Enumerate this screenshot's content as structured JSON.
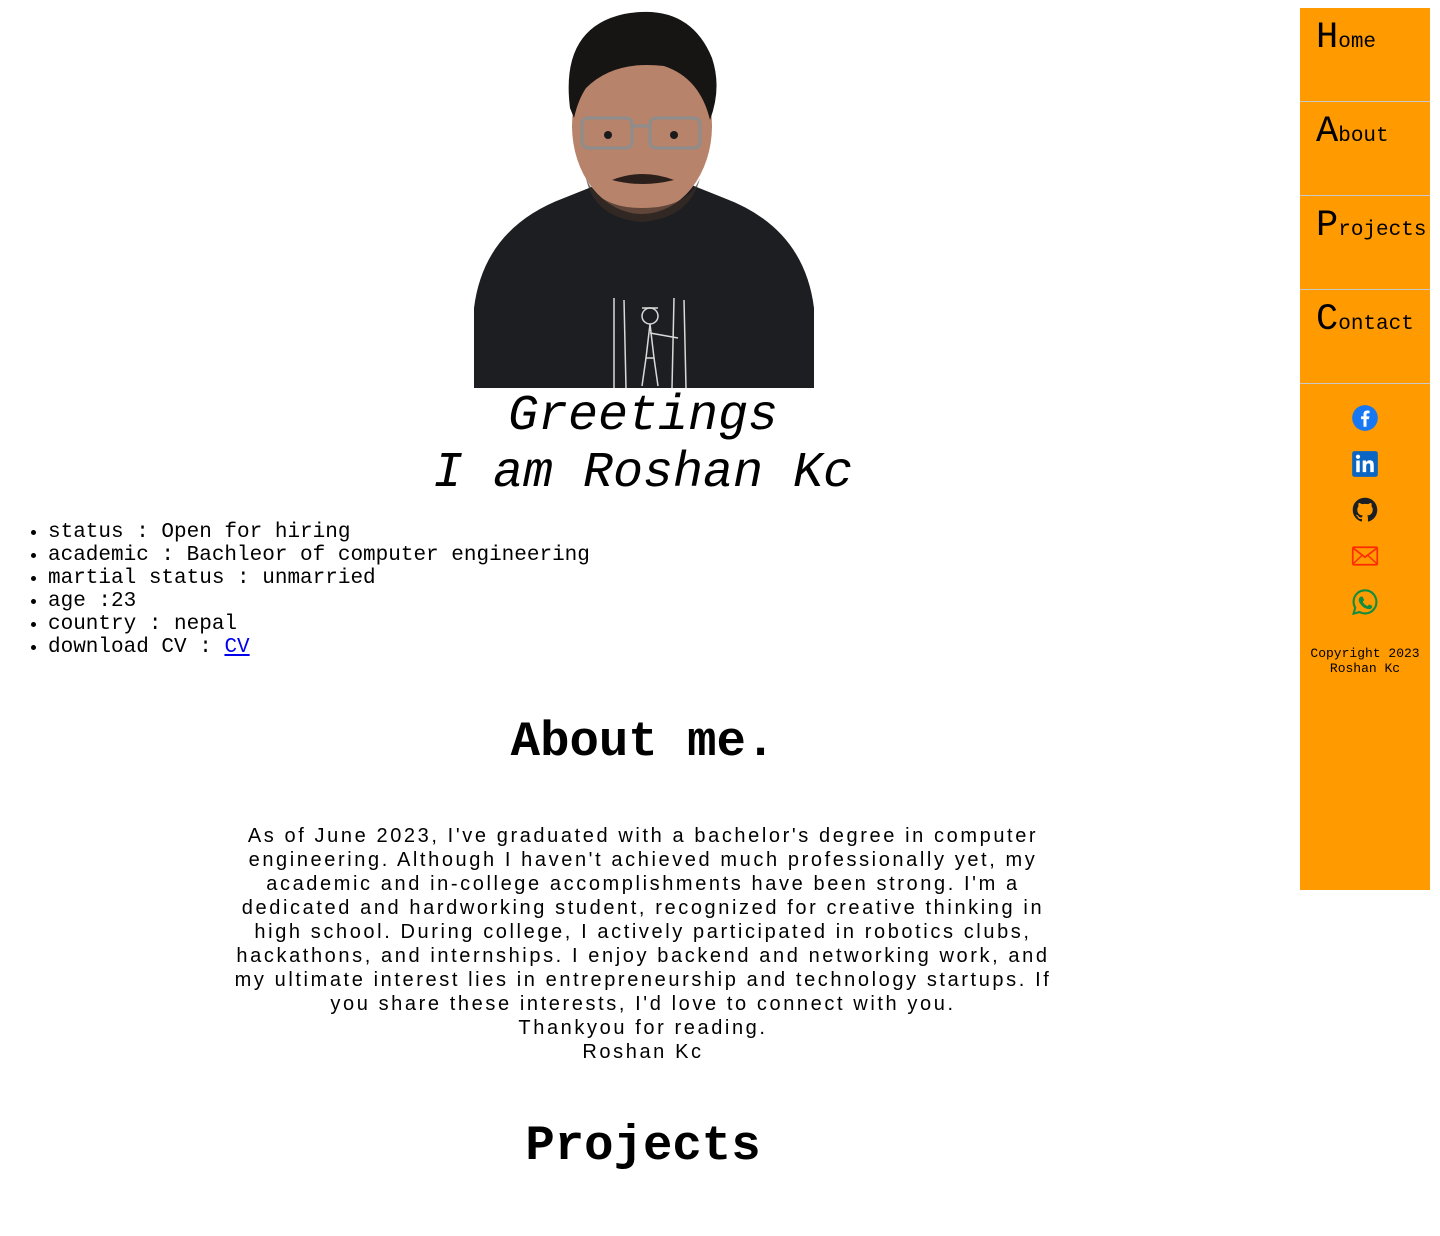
{
  "hero": {
    "greeting": "Greetings",
    "intro": "I am Roshan Kc"
  },
  "info": {
    "items": [
      {
        "text": "status : Open for hiring"
      },
      {
        "text": "academic : Bachleor of computer engineering"
      },
      {
        "text": "martial status : unmarried"
      },
      {
        "text": "age :23"
      },
      {
        "text": "country : nepal"
      },
      {
        "text": "download CV : ",
        "link": "CV"
      }
    ]
  },
  "about": {
    "title": "About me.",
    "body": "As of June 2023, I've graduated with a bachelor's degree in computer engineering. Although I haven't achieved much professionally yet, my academic and in-college accomplishments have been strong. I'm a dedicated and hardworking student, recognized for creative thinking in high school. During college, I actively participated in robotics clubs, hackathons, and internships. I enjoy backend and networking work, and my ultimate interest lies in entrepreneurship and technology startups. If you share these interests, I'd love to connect with you.",
    "thanks": "Thankyou for reading.",
    "signature": "Roshan Kc"
  },
  "projects": {
    "title": "Projects"
  },
  "nav": {
    "items": [
      {
        "cap": "H",
        "rest": "ome"
      },
      {
        "cap": "A",
        "rest": "bout"
      },
      {
        "cap": "P",
        "rest": "rojects"
      },
      {
        "cap": "C",
        "rest": "ontact"
      }
    ],
    "socials": [
      {
        "icon": "facebook-icon",
        "color": "#1877f2"
      },
      {
        "icon": "linkedin-icon",
        "color": "#0a66c2"
      },
      {
        "icon": "github-icon",
        "color": "#1b1f23"
      },
      {
        "icon": "mail-icon",
        "color": "#ff2a00"
      },
      {
        "icon": "whatsapp-icon",
        "color": "#128c3e"
      }
    ],
    "copyright_line1": "Copyright 2023",
    "copyright_line2": "Roshan Kc"
  },
  "colors": {
    "nav_background": "#ff9a00",
    "link": "#0000ee"
  }
}
